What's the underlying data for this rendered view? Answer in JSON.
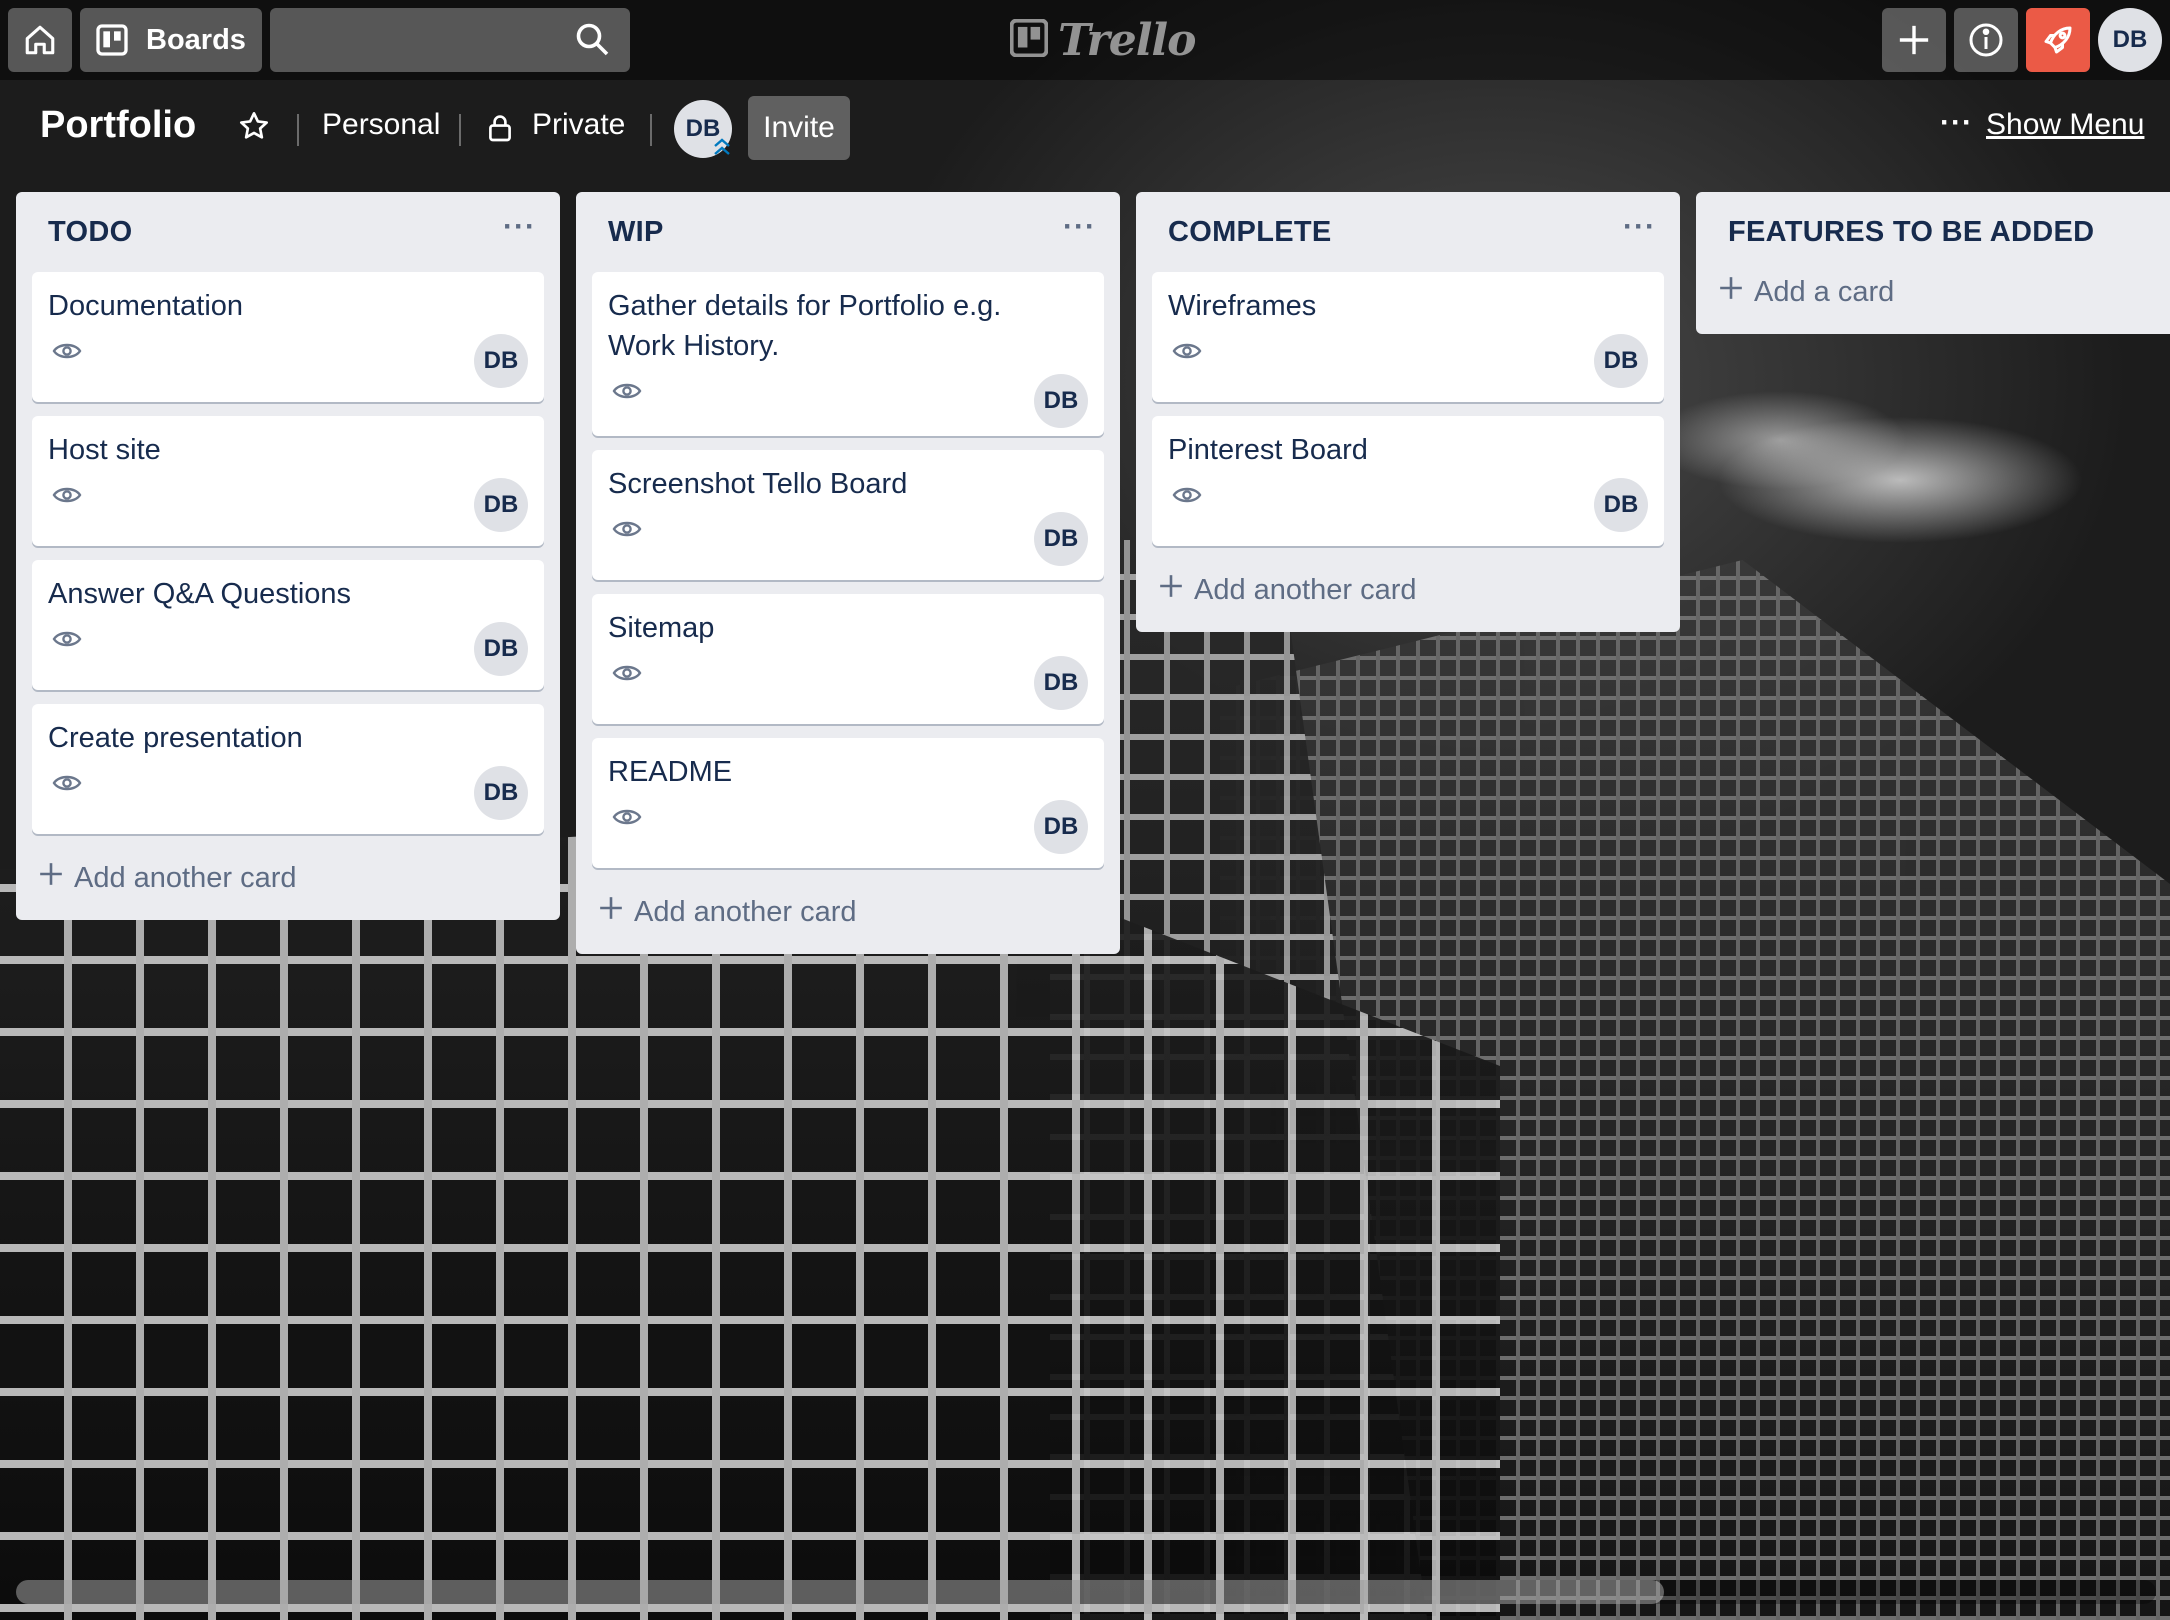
{
  "header": {
    "boards_label": "Boards",
    "search": {
      "value": "",
      "placeholder": ""
    },
    "logo_text": "Trello",
    "user_initials": "DB"
  },
  "board": {
    "title": "Portfolio",
    "team": "Personal",
    "visibility": "Private",
    "member_initials": "DB",
    "invite_label": "Invite",
    "show_menu_label": "Show Menu"
  },
  "lists": [
    {
      "title": "TODO",
      "cards": [
        {
          "title": "Documentation",
          "member": "DB"
        },
        {
          "title": "Host site",
          "member": "DB"
        },
        {
          "title": "Answer Q&A Questions",
          "member": "DB"
        },
        {
          "title": "Create presentation",
          "member": "DB"
        }
      ],
      "add_label": "Add another card"
    },
    {
      "title": "WIP",
      "cards": [
        {
          "title": "Gather details for Portfolio e.g. Work History.",
          "member": "DB"
        },
        {
          "title": "Screenshot Tello Board",
          "member": "DB"
        },
        {
          "title": "Sitemap",
          "member": "DB"
        },
        {
          "title": "README",
          "member": "DB"
        }
      ],
      "add_label": "Add another card"
    },
    {
      "title": "COMPLETE",
      "cards": [
        {
          "title": "Wireframes",
          "member": "DB"
        },
        {
          "title": "Pinterest Board",
          "member": "DB"
        }
      ],
      "add_label": "Add another card"
    },
    {
      "title": "FEATURES TO BE ADDED",
      "cards": [],
      "add_label": "Add a card"
    }
  ],
  "icons": {
    "home": "home-icon",
    "boards": "boards-icon",
    "search": "search-icon",
    "create": "plus-icon",
    "info": "info-icon",
    "notifications": "rocket-icon",
    "star": "star-icon",
    "lock": "lock-icon",
    "watch": "eye-icon"
  },
  "colors": {
    "accent_rocket": "#eb5a46",
    "list_bg": "#ebecf0",
    "card_text": "#172b4d",
    "muted_text": "#5e6c84"
  },
  "scrollbar": {
    "visible_fraction": 0.77
  }
}
